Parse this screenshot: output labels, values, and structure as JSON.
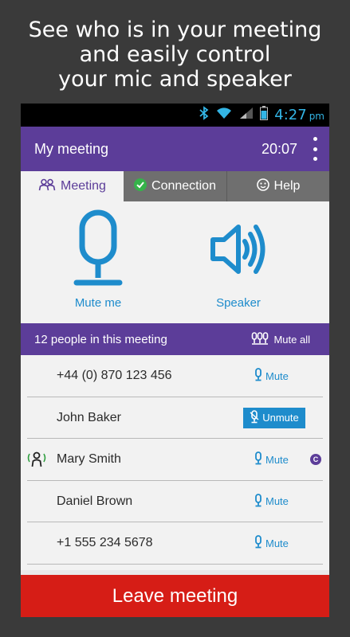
{
  "promo": {
    "line1": "See who is in your meeting",
    "line2": "and easily control",
    "line3": "your mic and speaker"
  },
  "status_bar": {
    "time": "4:27",
    "ampm": "pm"
  },
  "app_bar": {
    "title": "My meeting",
    "timer": "20:07"
  },
  "tabs": [
    {
      "label": "Meeting",
      "icon": "people-icon",
      "active": true
    },
    {
      "label": "Connection",
      "icon": "check-circle-icon",
      "active": false
    },
    {
      "label": "Help",
      "icon": "help-face-icon",
      "active": false
    }
  ],
  "controls": {
    "mic_label": "Mute me",
    "speaker_label": "Speaker"
  },
  "people_bar": {
    "count_text": "12 people in this meeting",
    "mute_all_label": "Mute all"
  },
  "participants": [
    {
      "name": "+44 (0) 870 123 456",
      "action": "Mute",
      "speaking": false,
      "badge": ""
    },
    {
      "name": "John Baker",
      "action": "Unmute",
      "speaking": false,
      "badge": ""
    },
    {
      "name": "Mary Smith",
      "action": "Mute",
      "speaking": true,
      "badge": "C"
    },
    {
      "name": "Daniel Brown",
      "action": "Mute",
      "speaking": false,
      "badge": ""
    },
    {
      "name": "+1 555 234 5678",
      "action": "Mute",
      "speaking": false,
      "badge": ""
    }
  ],
  "leave_button": {
    "label": "Leave meeting"
  },
  "colors": {
    "purple": "#5c3d99",
    "blue": "#1e8ccc",
    "red": "#d61d16",
    "green": "#2e9e3e"
  }
}
